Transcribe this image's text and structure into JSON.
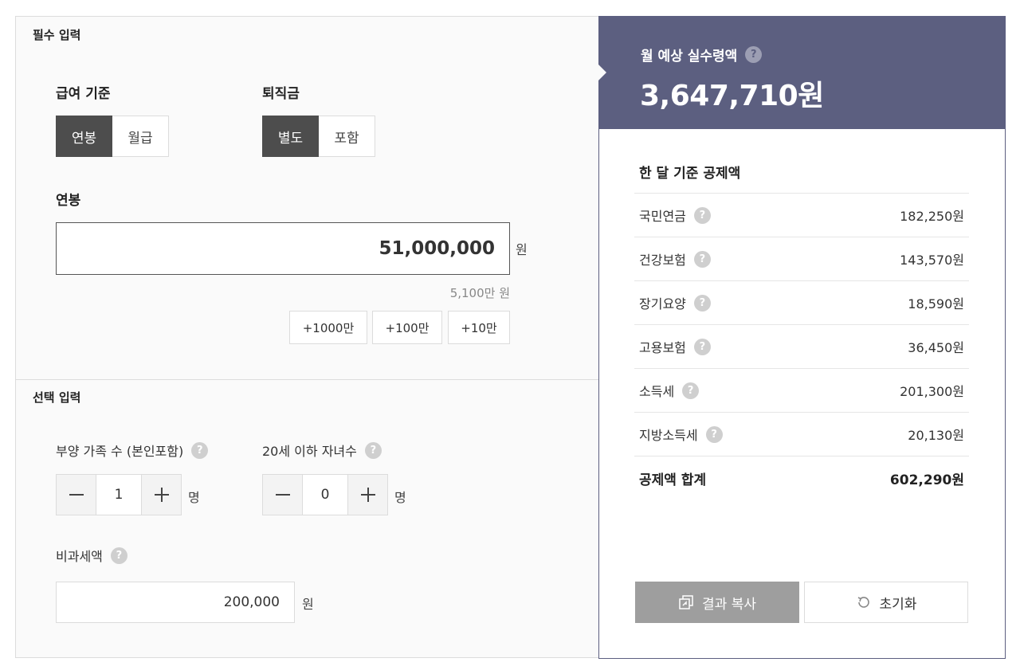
{
  "required_section": {
    "title": "필수 입력",
    "pay_basis": {
      "label": "급여 기준",
      "options": [
        "연봉",
        "월급"
      ],
      "selected": "연봉"
    },
    "severance": {
      "label": "퇴직금",
      "options": [
        "별도",
        "포함"
      ],
      "selected": "별도"
    },
    "salary": {
      "label": "연봉",
      "value": "51,000,000",
      "unit": "원",
      "hint": "5,100만 원"
    },
    "quick_add": [
      "+1000만",
      "+100만",
      "+10만"
    ]
  },
  "optional_section": {
    "title": "선택 입력",
    "dependents": {
      "label": "부양 가족 수 (본인포함)",
      "value": "1",
      "unit": "명"
    },
    "children": {
      "label": "20세 이하 자녀수",
      "value": "0",
      "unit": "명"
    },
    "nontaxable": {
      "label": "비과세액",
      "value": "200,000",
      "unit": "원"
    }
  },
  "result": {
    "title": "월 예상 실수령액",
    "amount": "3,647,710원",
    "deductions_title": "한 달 기준 공제액",
    "deductions": [
      {
        "name": "국민연금",
        "amount": "182,250원"
      },
      {
        "name": "건강보험",
        "amount": "143,570원"
      },
      {
        "name": "장기요양",
        "amount": "18,590원"
      },
      {
        "name": "고용보험",
        "amount": "36,450원"
      },
      {
        "name": "소득세",
        "amount": "201,300원"
      },
      {
        "name": "지방소득세",
        "amount": "20,130원"
      }
    ],
    "total": {
      "name": "공제액 합계",
      "amount": "602,290원"
    },
    "copy_button": "결과 복사",
    "reset_button": "초기화"
  },
  "help_glyph": "?",
  "colors": {
    "result_header": "#5c5f80",
    "active_toggle": "#4d4d4d",
    "copy_button": "#9e9e9e"
  },
  "icons": [
    "help-icon",
    "minus-icon",
    "plus-icon",
    "copy-icon",
    "reset-icon"
  ]
}
